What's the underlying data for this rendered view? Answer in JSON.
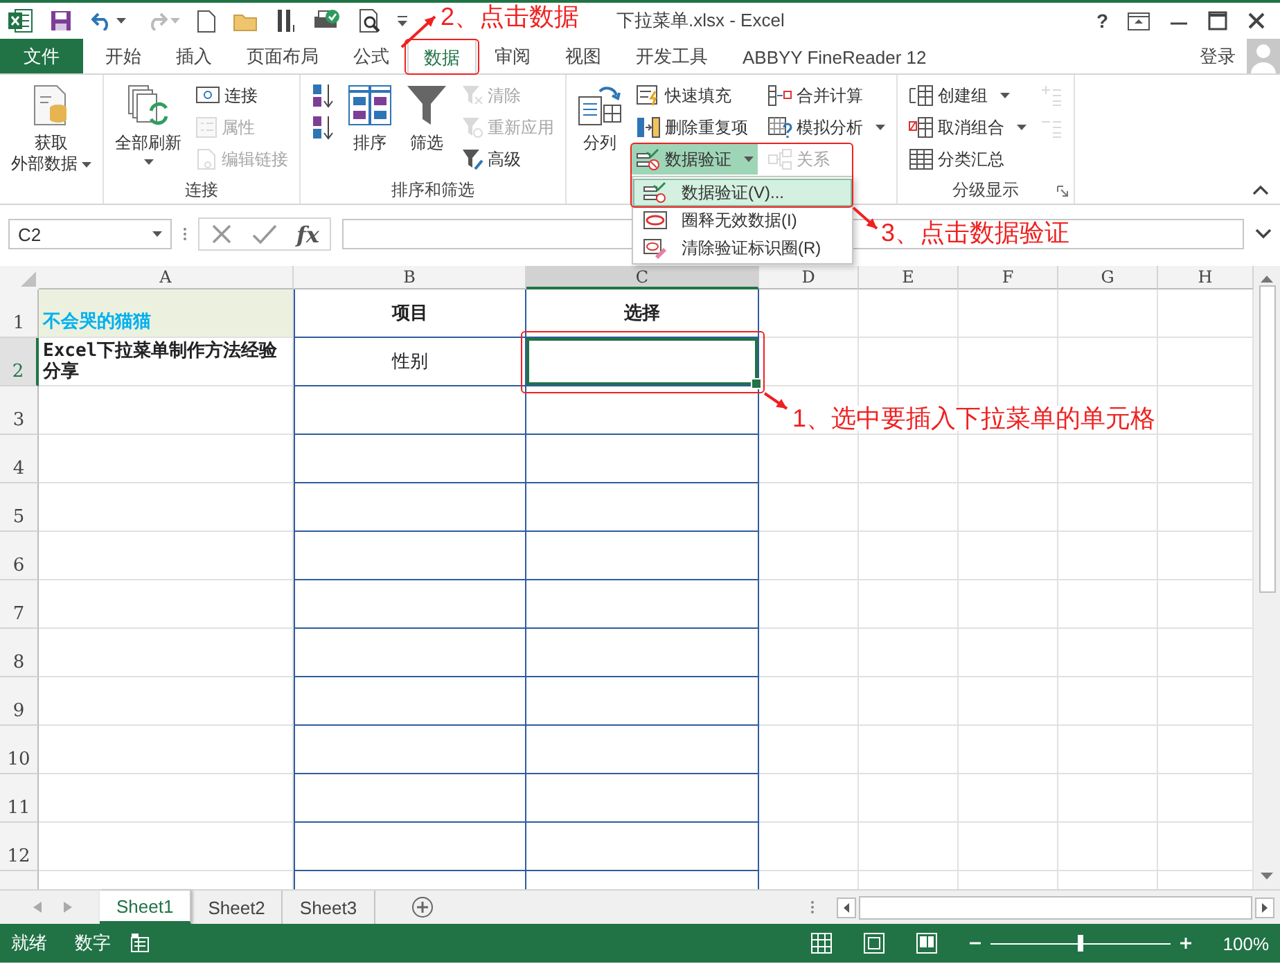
{
  "window": {
    "title": "下拉菜单.xlsx - Excel",
    "help": "?"
  },
  "tabs": [
    {
      "label": "文件",
      "kind": "file",
      "selected": false
    },
    {
      "label": "开始",
      "kind": "tab",
      "selected": false
    },
    {
      "label": "插入",
      "kind": "tab",
      "selected": false
    },
    {
      "label": "页面布局",
      "kind": "tab",
      "selected": false
    },
    {
      "label": "公式",
      "kind": "tab",
      "selected": false
    },
    {
      "label": "数据",
      "kind": "tab",
      "selected": true
    },
    {
      "label": "审阅",
      "kind": "tab",
      "selected": false
    },
    {
      "label": "视图",
      "kind": "tab",
      "selected": false
    },
    {
      "label": "开发工具",
      "kind": "tab",
      "selected": false
    },
    {
      "label": "ABBYY FineReader 12",
      "kind": "tab",
      "selected": false
    }
  ],
  "account": {
    "sign_in": "登录"
  },
  "ribbon": {
    "groups": [
      {
        "items": [
          {
            "lines": [
              "获取",
              "外部数据"
            ],
            "kind": "large",
            "dropdown": true,
            "disabled": false,
            "highlighted": false
          }
        ]
      },
      {
        "label": "连接",
        "items": [
          {
            "label": "全部刷新",
            "kind": "large",
            "dropdown": true,
            "disabled": false,
            "highlighted": false
          },
          {
            "label": "连接",
            "kind": "small",
            "dropdown": false,
            "disabled": false,
            "highlighted": false
          },
          {
            "label": "属性",
            "kind": "small",
            "dropdown": false,
            "disabled": true,
            "highlighted": false
          },
          {
            "label": "编辑链接",
            "kind": "small",
            "dropdown": false,
            "disabled": true,
            "highlighted": false
          }
        ]
      },
      {
        "label": "排序和筛选",
        "items": [
          {
            "kind": "small",
            "dropdown": false,
            "disabled": false,
            "highlighted": false
          },
          {
            "kind": "small",
            "dropdown": false,
            "disabled": false,
            "highlighted": false
          },
          {
            "label": "排序",
            "kind": "large",
            "dropdown": false,
            "disabled": false,
            "highlighted": false
          },
          {
            "label": "筛选",
            "kind": "large",
            "dropdown": false,
            "disabled": false,
            "highlighted": false
          },
          {
            "label": "清除",
            "kind": "small",
            "dropdown": false,
            "disabled": true,
            "highlighted": false
          },
          {
            "label": "重新应用",
            "kind": "small",
            "dropdown": false,
            "disabled": true,
            "highlighted": false
          },
          {
            "label": "高级",
            "kind": "small",
            "dropdown": false,
            "disabled": false,
            "highlighted": false
          }
        ]
      },
      {
        "items": [
          {
            "label": "分列",
            "kind": "large",
            "dropdown": false,
            "disabled": false,
            "highlighted": false
          },
          {
            "label": "快速填充",
            "kind": "small",
            "dropdown": false,
            "disabled": false,
            "highlighted": false
          },
          {
            "label": "删除重复项",
            "kind": "small",
            "dropdown": false,
            "disabled": false,
            "highlighted": false
          },
          {
            "label": "数据验证",
            "kind": "small",
            "dropdown": true,
            "disabled": false,
            "highlighted": true
          },
          {
            "label": "合并计算",
            "kind": "small",
            "dropdown": false,
            "disabled": false,
            "highlighted": false
          },
          {
            "label": "模拟分析",
            "kind": "small",
            "dropdown": true,
            "disabled": false,
            "highlighted": false
          },
          {
            "label": "关系",
            "kind": "small",
            "dropdown": false,
            "disabled": true,
            "highlighted": false
          }
        ]
      },
      {
        "label": "分级显示",
        "items": [
          {
            "label": "创建组",
            "kind": "small",
            "dropdown": true,
            "disabled": false,
            "highlighted": false
          },
          {
            "label": "取消组合",
            "kind": "small",
            "dropdown": true,
            "disabled": false,
            "highlighted": false
          },
          {
            "label": "分类汇总",
            "kind": "small",
            "dropdown": false,
            "disabled": false,
            "highlighted": false
          },
          {
            "kind": "small",
            "dropdown": false,
            "disabled": true,
            "highlighted": false
          },
          {
            "kind": "small",
            "dropdown": false,
            "disabled": true,
            "highlighted": false
          }
        ]
      }
    ]
  },
  "validation_menu": {
    "items": [
      {
        "label": "数据验证(V)...",
        "selected": true
      },
      {
        "label": "圈释无效数据(I)",
        "selected": false
      },
      {
        "label": "清除验证标识圈(R)",
        "selected": false
      }
    ]
  },
  "formula_bar": {
    "name_box": "C2",
    "function_label": "fx"
  },
  "grid": {
    "columns": [
      {
        "label": "A",
        "selected": false
      },
      {
        "label": "B",
        "selected": false
      },
      {
        "label": "C",
        "selected": true
      },
      {
        "label": "D",
        "selected": false
      },
      {
        "label": "E",
        "selected": false
      },
      {
        "label": "F",
        "selected": false
      },
      {
        "label": "G",
        "selected": false
      },
      {
        "label": "H",
        "selected": false
      }
    ],
    "rows": [
      {
        "label": "1",
        "selected": false,
        "cells": [
          "不会哭的猫猫",
          "项目",
          "选择",
          null,
          null,
          null,
          null,
          null
        ]
      },
      {
        "label": "2",
        "selected": true,
        "cells": [
          "Excel下拉菜单制作方法经验分享",
          "性别",
          null,
          null,
          null,
          null,
          null,
          null
        ]
      },
      {
        "label": "3",
        "selected": false,
        "cells": [
          null,
          null,
          null,
          null,
          null,
          null,
          null,
          null
        ]
      },
      {
        "label": "4",
        "selected": false,
        "cells": [
          null,
          null,
          null,
          null,
          null,
          null,
          null,
          null
        ]
      },
      {
        "label": "5",
        "selected": false,
        "cells": [
          null,
          null,
          null,
          null,
          null,
          null,
          null,
          null
        ]
      },
      {
        "label": "6",
        "selected": false,
        "cells": [
          null,
          null,
          null,
          null,
          null,
          null,
          null,
          null
        ]
      },
      {
        "label": "7",
        "selected": false,
        "cells": [
          null,
          null,
          null,
          null,
          null,
          null,
          null,
          null
        ]
      },
      {
        "label": "8",
        "selected": false,
        "cells": [
          null,
          null,
          null,
          null,
          null,
          null,
          null,
          null
        ]
      },
      {
        "label": "9",
        "selected": false,
        "cells": [
          null,
          null,
          null,
          null,
          null,
          null,
          null,
          null
        ]
      },
      {
        "label": "10",
        "selected": false,
        "cells": [
          null,
          null,
          null,
          null,
          null,
          null,
          null,
          null
        ]
      },
      {
        "label": "11",
        "selected": false,
        "cells": [
          null,
          null,
          null,
          null,
          null,
          null,
          null,
          null
        ]
      },
      {
        "label": "12",
        "selected": false,
        "cells": [
          null,
          null,
          null,
          null,
          null,
          null,
          null,
          null
        ]
      }
    ]
  },
  "sheets": [
    {
      "label": "Sheet1",
      "selected": true
    },
    {
      "label": "Sheet2",
      "selected": false
    },
    {
      "label": "Sheet3",
      "selected": false
    }
  ],
  "status_bar": {
    "items": [
      "就绪",
      "数字"
    ],
    "zoom": {
      "level": 0.5,
      "reading": "100%"
    }
  },
  "annotations": [
    {
      "text": "2、点击数据"
    },
    {
      "text": "3、点击数据验证"
    },
    {
      "text": "1、选中要插入下拉菜单的单元格"
    }
  ]
}
